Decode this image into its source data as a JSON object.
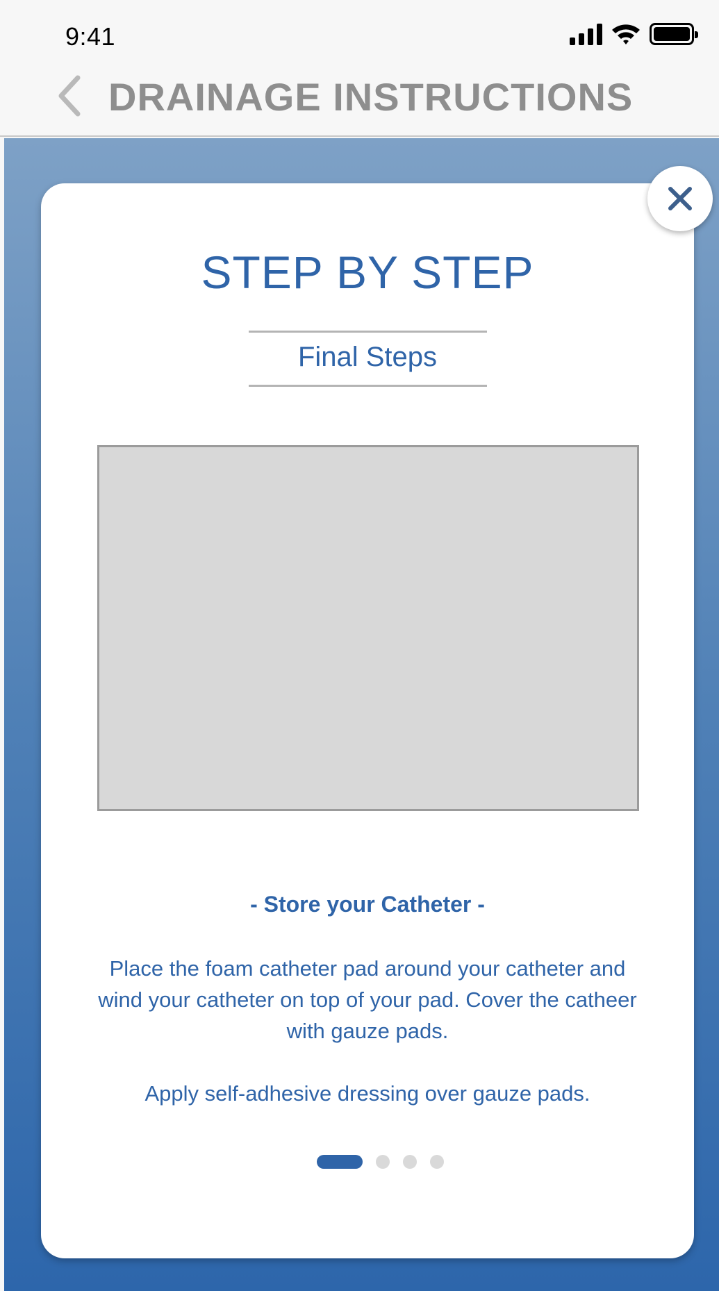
{
  "status_bar": {
    "time": "9:41"
  },
  "nav": {
    "title": "DRAINAGE INSTRUCTIONS"
  },
  "card": {
    "title": "STEP BY STEP",
    "subtitle": "Final Steps",
    "step_heading": "- Store your Catheter -",
    "paragraphs": [
      "Place the foam catheter pad around your catheter and wind your catheter on top of your pad. Cover the catheer with gauze pads.",
      "Apply self-adhesive dressing over gauze pads."
    ]
  },
  "pager": {
    "total_pages": 4,
    "current_page": 1
  },
  "icons": {
    "back": "chevron-left-icon",
    "close": "close-icon",
    "signal": "cellular-signal-icon",
    "wifi": "wifi-icon",
    "battery": "battery-icon"
  },
  "colors": {
    "accent": "#2f64a8",
    "nav_title": "#8e8e8e",
    "backdrop_top": "#7ea1c6",
    "backdrop_bottom": "#2d66ab"
  }
}
